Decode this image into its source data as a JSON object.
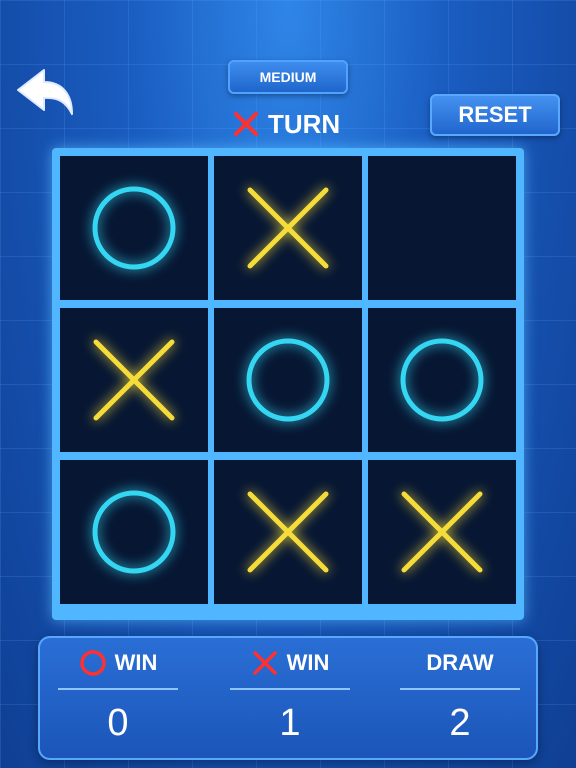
{
  "header": {
    "difficulty_label": "MEDIUM",
    "turn_mark": "X",
    "turn_label": "TURN",
    "reset_label": "RESET"
  },
  "board": {
    "cells": [
      "O",
      "X",
      "",
      "X",
      "O",
      "O",
      "O",
      "X",
      "X"
    ]
  },
  "scoreboard": {
    "o_win": {
      "mark": "O",
      "label": "WIN",
      "value": "0"
    },
    "x_win": {
      "mark": "X",
      "label": "WIN",
      "value": "1"
    },
    "draw": {
      "label": "DRAW",
      "value": "2"
    }
  },
  "colors": {
    "o_mark": "#35d6f2",
    "x_mark": "#f5dc3a",
    "score_icon": "#ff3030",
    "board_frame": "#4fb6ff",
    "cell_bg": "#071733"
  },
  "icons": {
    "back": "back-arrow-icon"
  }
}
